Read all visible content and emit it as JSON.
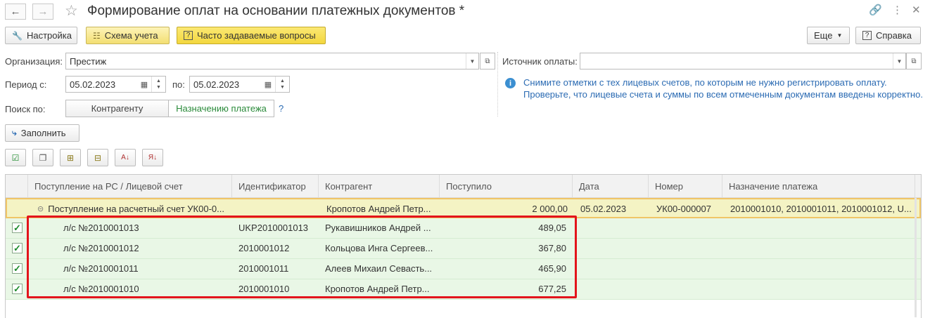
{
  "window": {
    "title": "Формирование оплат на основании платежных документов *"
  },
  "toolbar": {
    "settings_label": "Настройка",
    "scheme_label": "Схема учета",
    "faq_label": "Часто задаваемые вопросы",
    "more_label": "Еще",
    "help_label": "Справка"
  },
  "form": {
    "org_label": "Организация:",
    "org_value": "Престиж",
    "period_label": "Период с:",
    "period_from": "05.02.2023",
    "period_to_label": "по:",
    "period_to": "05.02.2023",
    "search_label": "Поиск по:",
    "search_counterparty": "Контрагенту",
    "search_purpose": "Назначению платежа",
    "search_help": "?",
    "source_label": "Источник оплаты:",
    "source_value": "",
    "fill_label": "Заполнить"
  },
  "info": {
    "line1": "Снимите отметки с тех лицевых счетов, по которым не нужно регистрировать оплату.",
    "line2": "Проверьте, что лицевые счета и суммы по всем отмеченным документам введены корректно."
  },
  "table": {
    "columns": [
      "Поступление на РС / Лицевой счет",
      "Идентификатор",
      "Контрагент",
      "Поступило",
      "Дата",
      "Номер",
      "Назначение платежа"
    ],
    "group": {
      "name": "Поступление на расчетный счет УК00-0...",
      "identifier": "",
      "counterparty": "Кропотов Андрей Петр...",
      "amount": "2 000,00",
      "date": "05.02.2023",
      "number": "УК00-000007",
      "purpose": "2010001010, 2010001011, 2010001012, U..."
    },
    "rows": [
      {
        "account": "л/с №2010001013",
        "identifier": "UKP2010001013",
        "counterparty": "Рукавишников Андрей ...",
        "amount": "489,05",
        "checked": "✓"
      },
      {
        "account": "л/с №2010001012",
        "identifier": "2010001012",
        "counterparty": "Кольцова Инга Сергеев...",
        "amount": "367,80",
        "checked": "✓"
      },
      {
        "account": "л/с №2010001011",
        "identifier": "2010001011",
        "counterparty": "Алеев Михаил Севасть...",
        "amount": "465,90",
        "checked": "✓"
      },
      {
        "account": "л/с №2010001010",
        "identifier": "2010001010",
        "counterparty": "Кропотов Андрей Петр...",
        "amount": "677,25",
        "checked": "✓"
      }
    ]
  },
  "icons": {
    "back": "arrow-left-icon",
    "forward": "arrow-right-icon",
    "favorite": "star-icon",
    "link": "link-icon",
    "menu": "kebab-menu-icon",
    "close": "close-icon"
  },
  "colors": {
    "group_row_bg": "#f4f3c4",
    "child_row_bg": "#e9f7e6",
    "highlight_frame": "#e3141c",
    "info_text": "#2b6bb3"
  }
}
